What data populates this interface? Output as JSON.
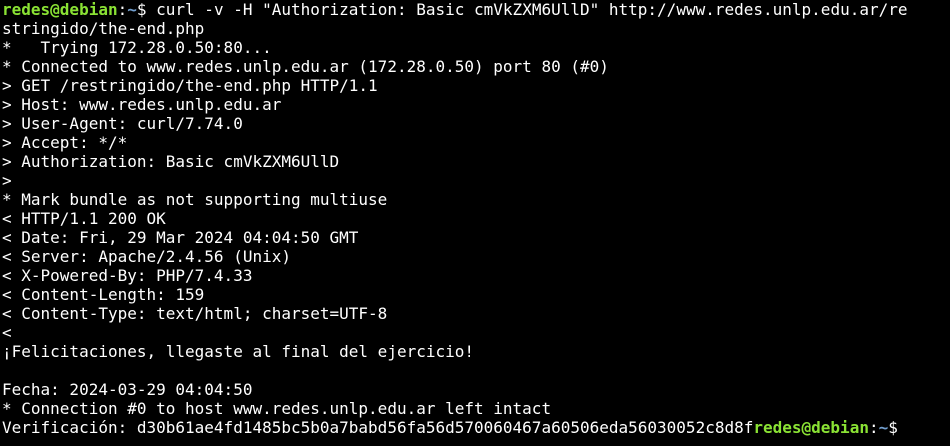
{
  "terminal": {
    "prompt": {
      "user_host": "redes@debian",
      "separator": ":",
      "path": "~",
      "symbol": "$ "
    },
    "command_line_1": "curl -v -H \"Authorization: Basic cmVkZXM6UllD\" http://www.redes.unlp.edu.ar/re",
    "command_line_2": "stringido/the-end.php",
    "output": [
      "*   Trying 172.28.0.50:80...",
      "* Connected to www.redes.unlp.edu.ar (172.28.0.50) port 80 (#0)",
      "> GET /restringido/the-end.php HTTP/1.1",
      "> Host: www.redes.unlp.edu.ar",
      "> User-Agent: curl/7.74.0",
      "> Accept: */*",
      "> Authorization: Basic cmVkZXM6UllD",
      ">",
      "* Mark bundle as not supporting multiuse",
      "< HTTP/1.1 200 OK",
      "< Date: Fri, 29 Mar 2024 04:04:50 GMT",
      "< Server: Apache/2.4.56 (Unix)",
      "< X-Powered-By: PHP/7.4.33",
      "< Content-Length: 159",
      "< Content-Type: text/html; charset=UTF-8",
      "<",
      "¡Felicitaciones, llegaste al final del ejercicio!",
      "",
      "Fecha: 2024-03-29 04:04:50",
      "* Connection #0 to host www.redes.unlp.edu.ar left intact"
    ],
    "last_line_text": "Verificación: d30b61ae4fd1485bc5b0a7babd56fa56d570060467a60506eda56030052c8d8f",
    "colors": {
      "background": "#000000",
      "foreground": "#ffffff",
      "prompt_user": "#8ae234",
      "prompt_path": "#729fcf"
    }
  }
}
